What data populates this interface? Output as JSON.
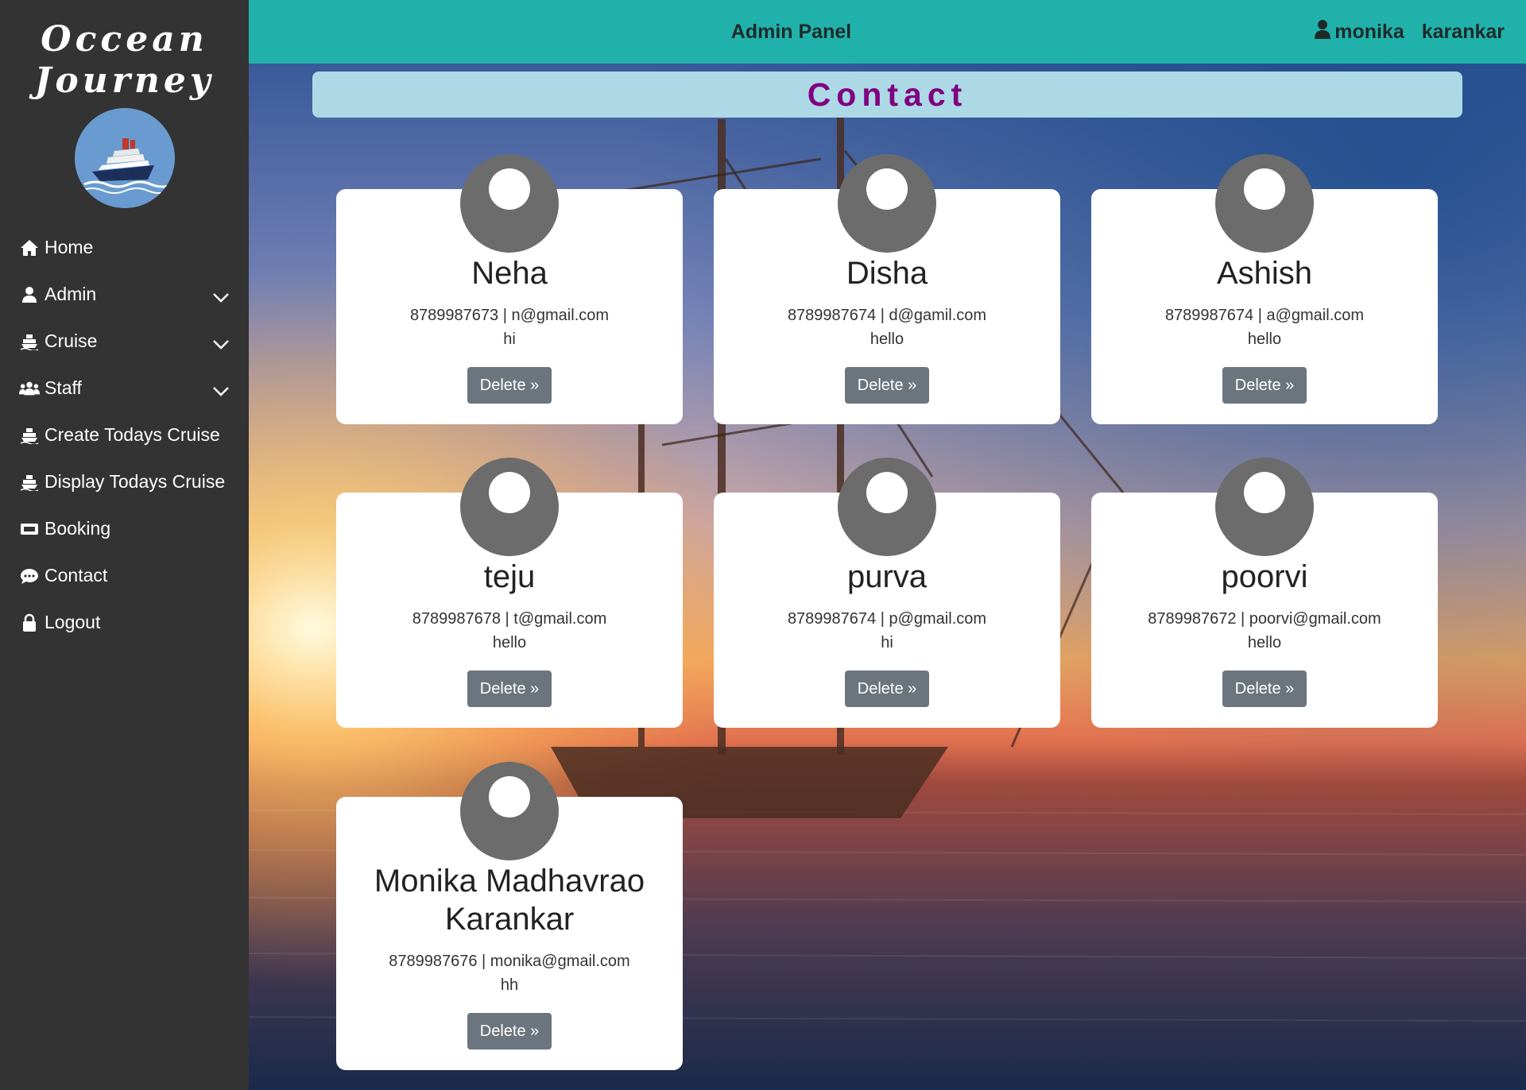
{
  "brand": {
    "line1": "Occean",
    "line2": "Journey"
  },
  "header": {
    "title": "Admin Panel",
    "user_first": "monika",
    "user_last": "karankar"
  },
  "sidebar": {
    "items": [
      {
        "label": "Home",
        "icon": "home-icon"
      },
      {
        "label": "Admin",
        "icon": "user-icon"
      },
      {
        "label": "Cruise",
        "icon": "ship-icon"
      },
      {
        "label": "Staff",
        "icon": "users-icon"
      },
      {
        "label": "Create Todays Cruise",
        "icon": "ship-icon"
      },
      {
        "label": "Display Todays Cruise",
        "icon": "ship-icon"
      },
      {
        "label": "Booking",
        "icon": "ticket-icon"
      },
      {
        "label": "Contact",
        "icon": "chat-icon"
      },
      {
        "label": "Logout",
        "icon": "lock-icon"
      }
    ]
  },
  "page": {
    "title": "Contact"
  },
  "contacts": [
    {
      "name": "Neha",
      "phone": "8789987673",
      "email": "n@gmail.com",
      "meta": "8789987673 | n@gmail.com",
      "message": "hi",
      "button": "Delete »"
    },
    {
      "name": "Disha",
      "phone": "8789987674",
      "email": "d@gamil.com",
      "meta": "8789987674 | d@gamil.com",
      "message": "hello",
      "button": "Delete »"
    },
    {
      "name": "Ashish",
      "phone": "8789987674",
      "email": "a@gmail.com",
      "meta": "8789987674 | a@gmail.com",
      "message": "hello",
      "button": "Delete »"
    },
    {
      "name": "teju",
      "phone": "8789987678",
      "email": "t@gmail.com",
      "meta": "8789987678 | t@gmail.com",
      "message": "hello",
      "button": "Delete »"
    },
    {
      "name": "purva",
      "phone": "8789987674",
      "email": "p@gmail.com",
      "meta": "8789987674 | p@gmail.com",
      "message": "hi",
      "button": "Delete »"
    },
    {
      "name": "poorvi",
      "phone": "8789987672",
      "email": "poorvi@gmail.com",
      "meta": "8789987672 | poorvi@gmail.com",
      "message": "hello",
      "button": "Delete »"
    },
    {
      "name": "Monika Madhavrao Karankar",
      "phone": "8789987676",
      "email": "monika@gmail.com",
      "meta": "8789987676 | monika@gmail.com",
      "message": "hh",
      "button": "Delete »"
    }
  ],
  "colors": {
    "sidebar": "#333333",
    "header": "#20b2aa",
    "title_bar": "#add8e6",
    "title_text": "#800080",
    "button": "#6c757d"
  }
}
